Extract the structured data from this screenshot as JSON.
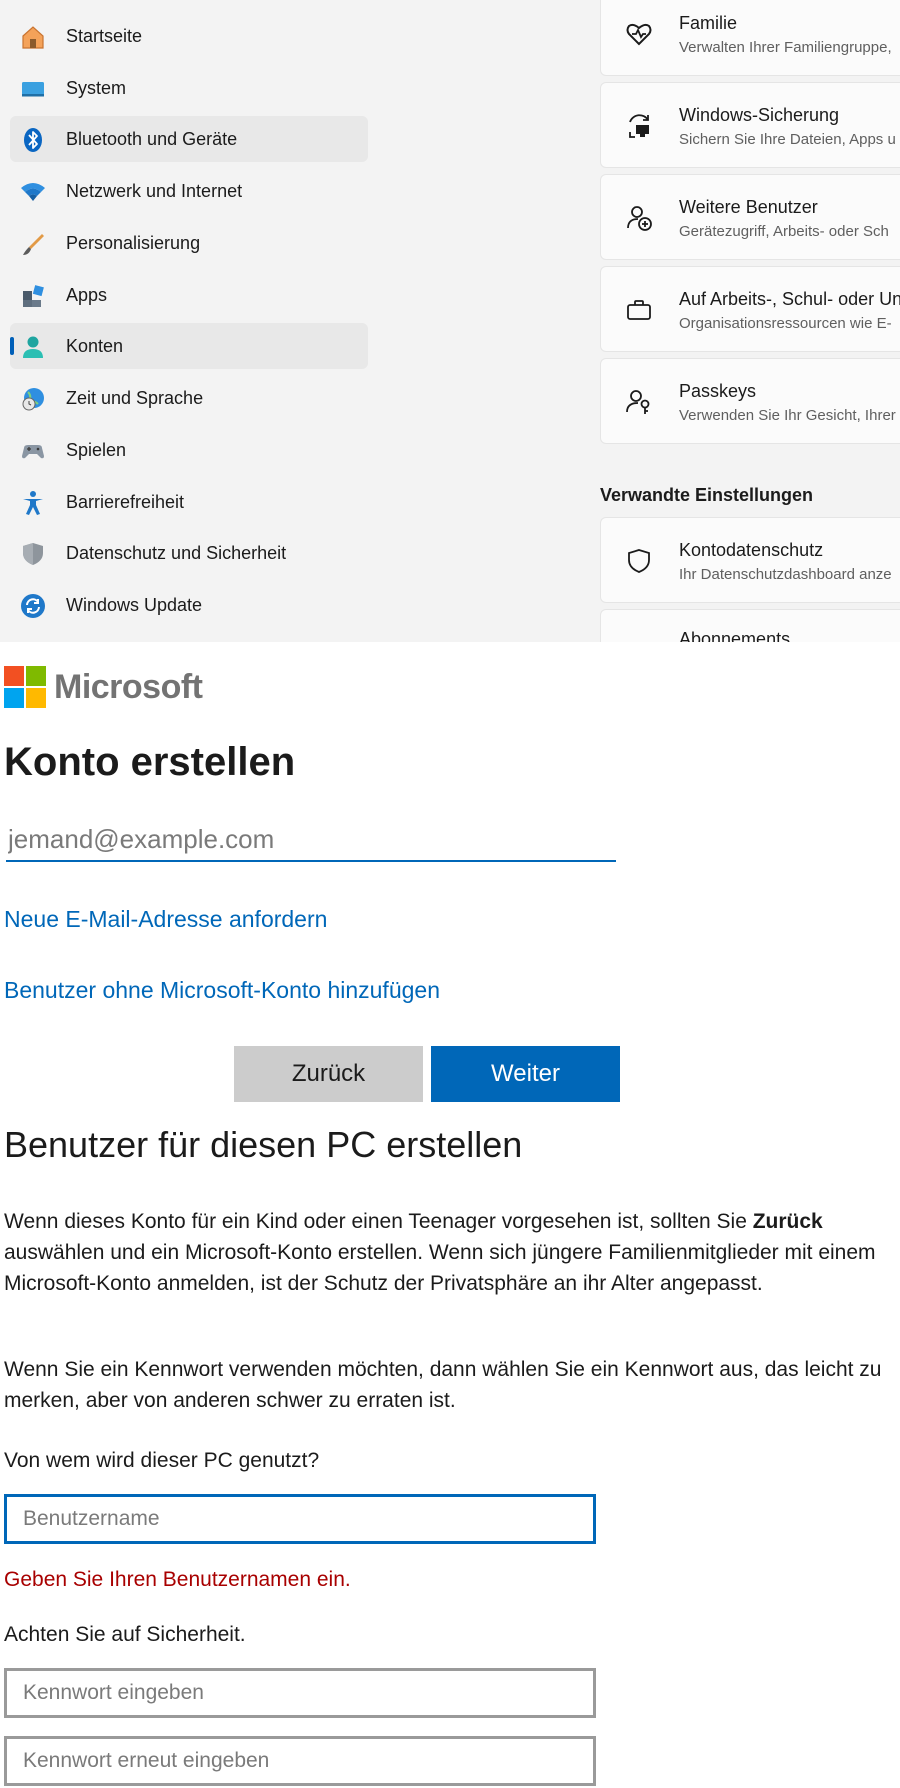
{
  "settings": {
    "nav": [
      {
        "label": "Startseite",
        "icon": "home-icon"
      },
      {
        "label": "System",
        "icon": "monitor-icon"
      },
      {
        "label": "Bluetooth und Geräte",
        "icon": "bluetooth-icon"
      },
      {
        "label": "Netzwerk und Internet",
        "icon": "wifi-icon"
      },
      {
        "label": "Personalisierung",
        "icon": "brush-icon"
      },
      {
        "label": "Apps",
        "icon": "apps-icon"
      },
      {
        "label": "Konten",
        "icon": "person-icon"
      },
      {
        "label": "Zeit und Sprache",
        "icon": "globe-clock-icon"
      },
      {
        "label": "Spielen",
        "icon": "gamepad-icon"
      },
      {
        "label": "Barrierefreiheit",
        "icon": "accessibility-icon"
      },
      {
        "label": "Datenschutz und Sicherheit",
        "icon": "shield-icon"
      },
      {
        "label": "Windows Update",
        "icon": "update-icon"
      }
    ],
    "hovered_item": "Bluetooth und Geräte",
    "selected_item": "Konten",
    "cards": [
      {
        "title": "Familie",
        "subtitle": "Verwalten Ihrer Familiengruppe,",
        "icon": "heart-icon"
      },
      {
        "title": "Windows-Sicherung",
        "subtitle": "Sichern Sie Ihre Dateien, Apps u",
        "icon": "backup-icon"
      },
      {
        "title": "Weitere Benutzer",
        "subtitle": "Gerätezugriff, Arbeits- oder Sch",
        "icon": "add-person-icon"
      },
      {
        "title": "Auf Arbeits-, Schul- oder Un",
        "subtitle": "Organisationsressourcen wie E-",
        "icon": "briefcase-icon"
      },
      {
        "title": "Passkeys",
        "subtitle": "Verwenden Sie Ihr Gesicht, Ihrer",
        "icon": "passkey-icon"
      }
    ],
    "related_heading": "Verwandte Einstellungen",
    "related_cards": [
      {
        "title": "Kontodatenschutz",
        "subtitle": "Ihr Datenschutzdashboard anze",
        "icon": "shield-outline-icon"
      },
      {
        "title": "Abonnements",
        "subtitle": "",
        "icon": "subscription-icon"
      }
    ],
    "accent_color": "#005fb8"
  },
  "microsoft": {
    "wordmark": "Microsoft",
    "title": "Konto erstellen",
    "email_placeholder": "jemand@example.com",
    "link_new_email": "Neue E-Mail-Adresse anfordern",
    "link_no_account": "Benutzer ohne Microsoft-Konto hinzufügen",
    "back_button": "Zurück",
    "next_button": "Weiter",
    "brand_color": "#0067b8"
  },
  "local_user": {
    "title": "Benutzer für diesen PC erstellen",
    "para1_before": "Wenn dieses Konto für ein Kind oder einen Teenager vorgesehen ist, sollten Sie ",
    "para1_bold": "Zurück",
    "para1_after": " auswählen und ein Microsoft-Konto erstellen. Wenn sich jüngere Familienmitglieder mit einem Microsoft-Konto anmelden, ist der Schutz der Privatsphäre an ihr Alter angepasst.",
    "para2": "Wenn Sie ein Kennwort verwenden möchten, dann wählen Sie ein Kennwort aus, das leicht zu merken, aber von anderen schwer zu erraten ist.",
    "who_label": "Von wem wird dieser PC genutzt?",
    "username_placeholder": "Benutzername",
    "error": "Geben Sie Ihren Benutzernamen ein.",
    "security_label": "Achten Sie auf Sicherheit.",
    "password_placeholder": "Kennwort eingeben",
    "password_confirm_placeholder": "Kennwort erneut eingeben",
    "error_color": "#a80000"
  }
}
